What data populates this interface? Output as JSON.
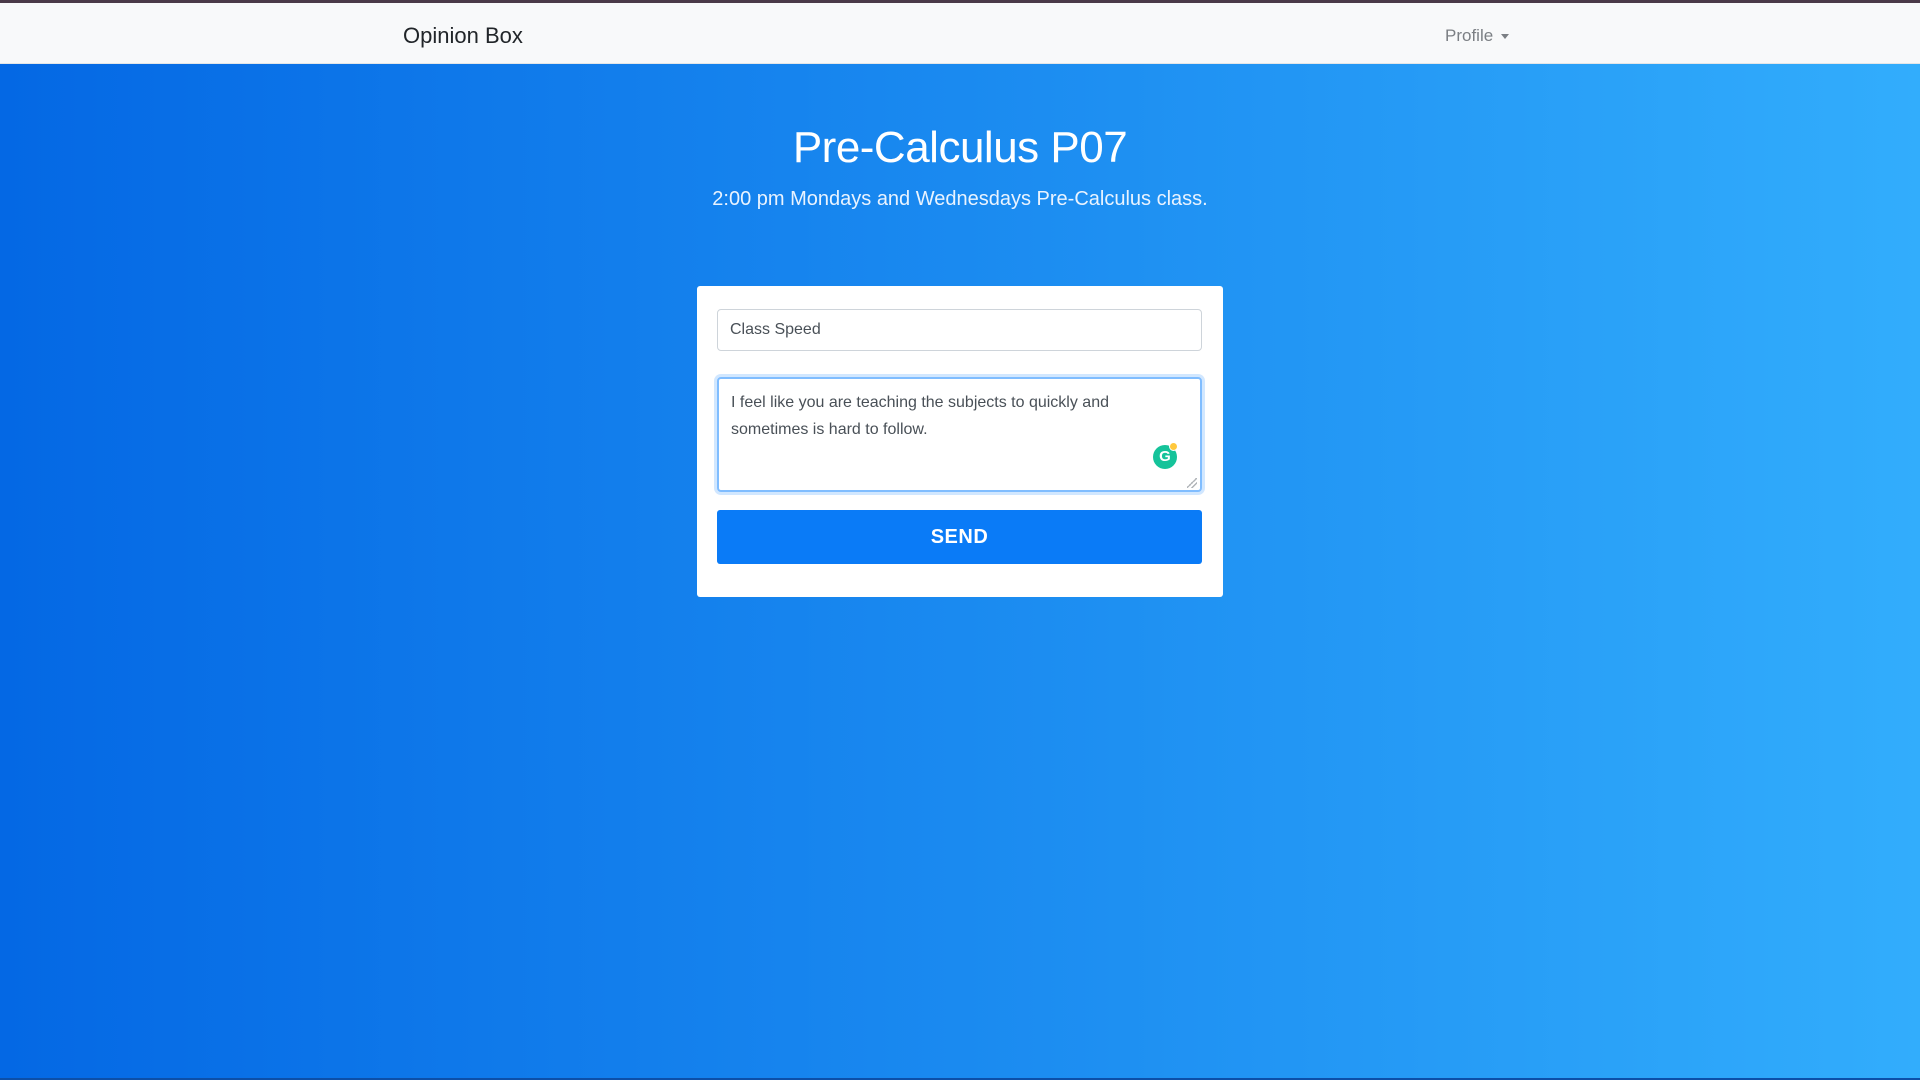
{
  "navbar": {
    "brand": "Opinion Box",
    "profile_label": "Profile"
  },
  "hero": {
    "title": "Pre-Calculus P07",
    "subtitle": "2:00 pm Mondays and Wednesdays Pre-Calculus class."
  },
  "form": {
    "subject_value": "Class Speed",
    "message_value": "I feel like you are teaching the subjects to quickly and sometimes is hard to follow.",
    "send_label": "SEND",
    "grammarly_letter": "G"
  },
  "colors": {
    "accent": "#0a7bf7",
    "gradient_start": "#0468e4",
    "gradient_end": "#32adfc",
    "grammarly": "#15c39a"
  }
}
